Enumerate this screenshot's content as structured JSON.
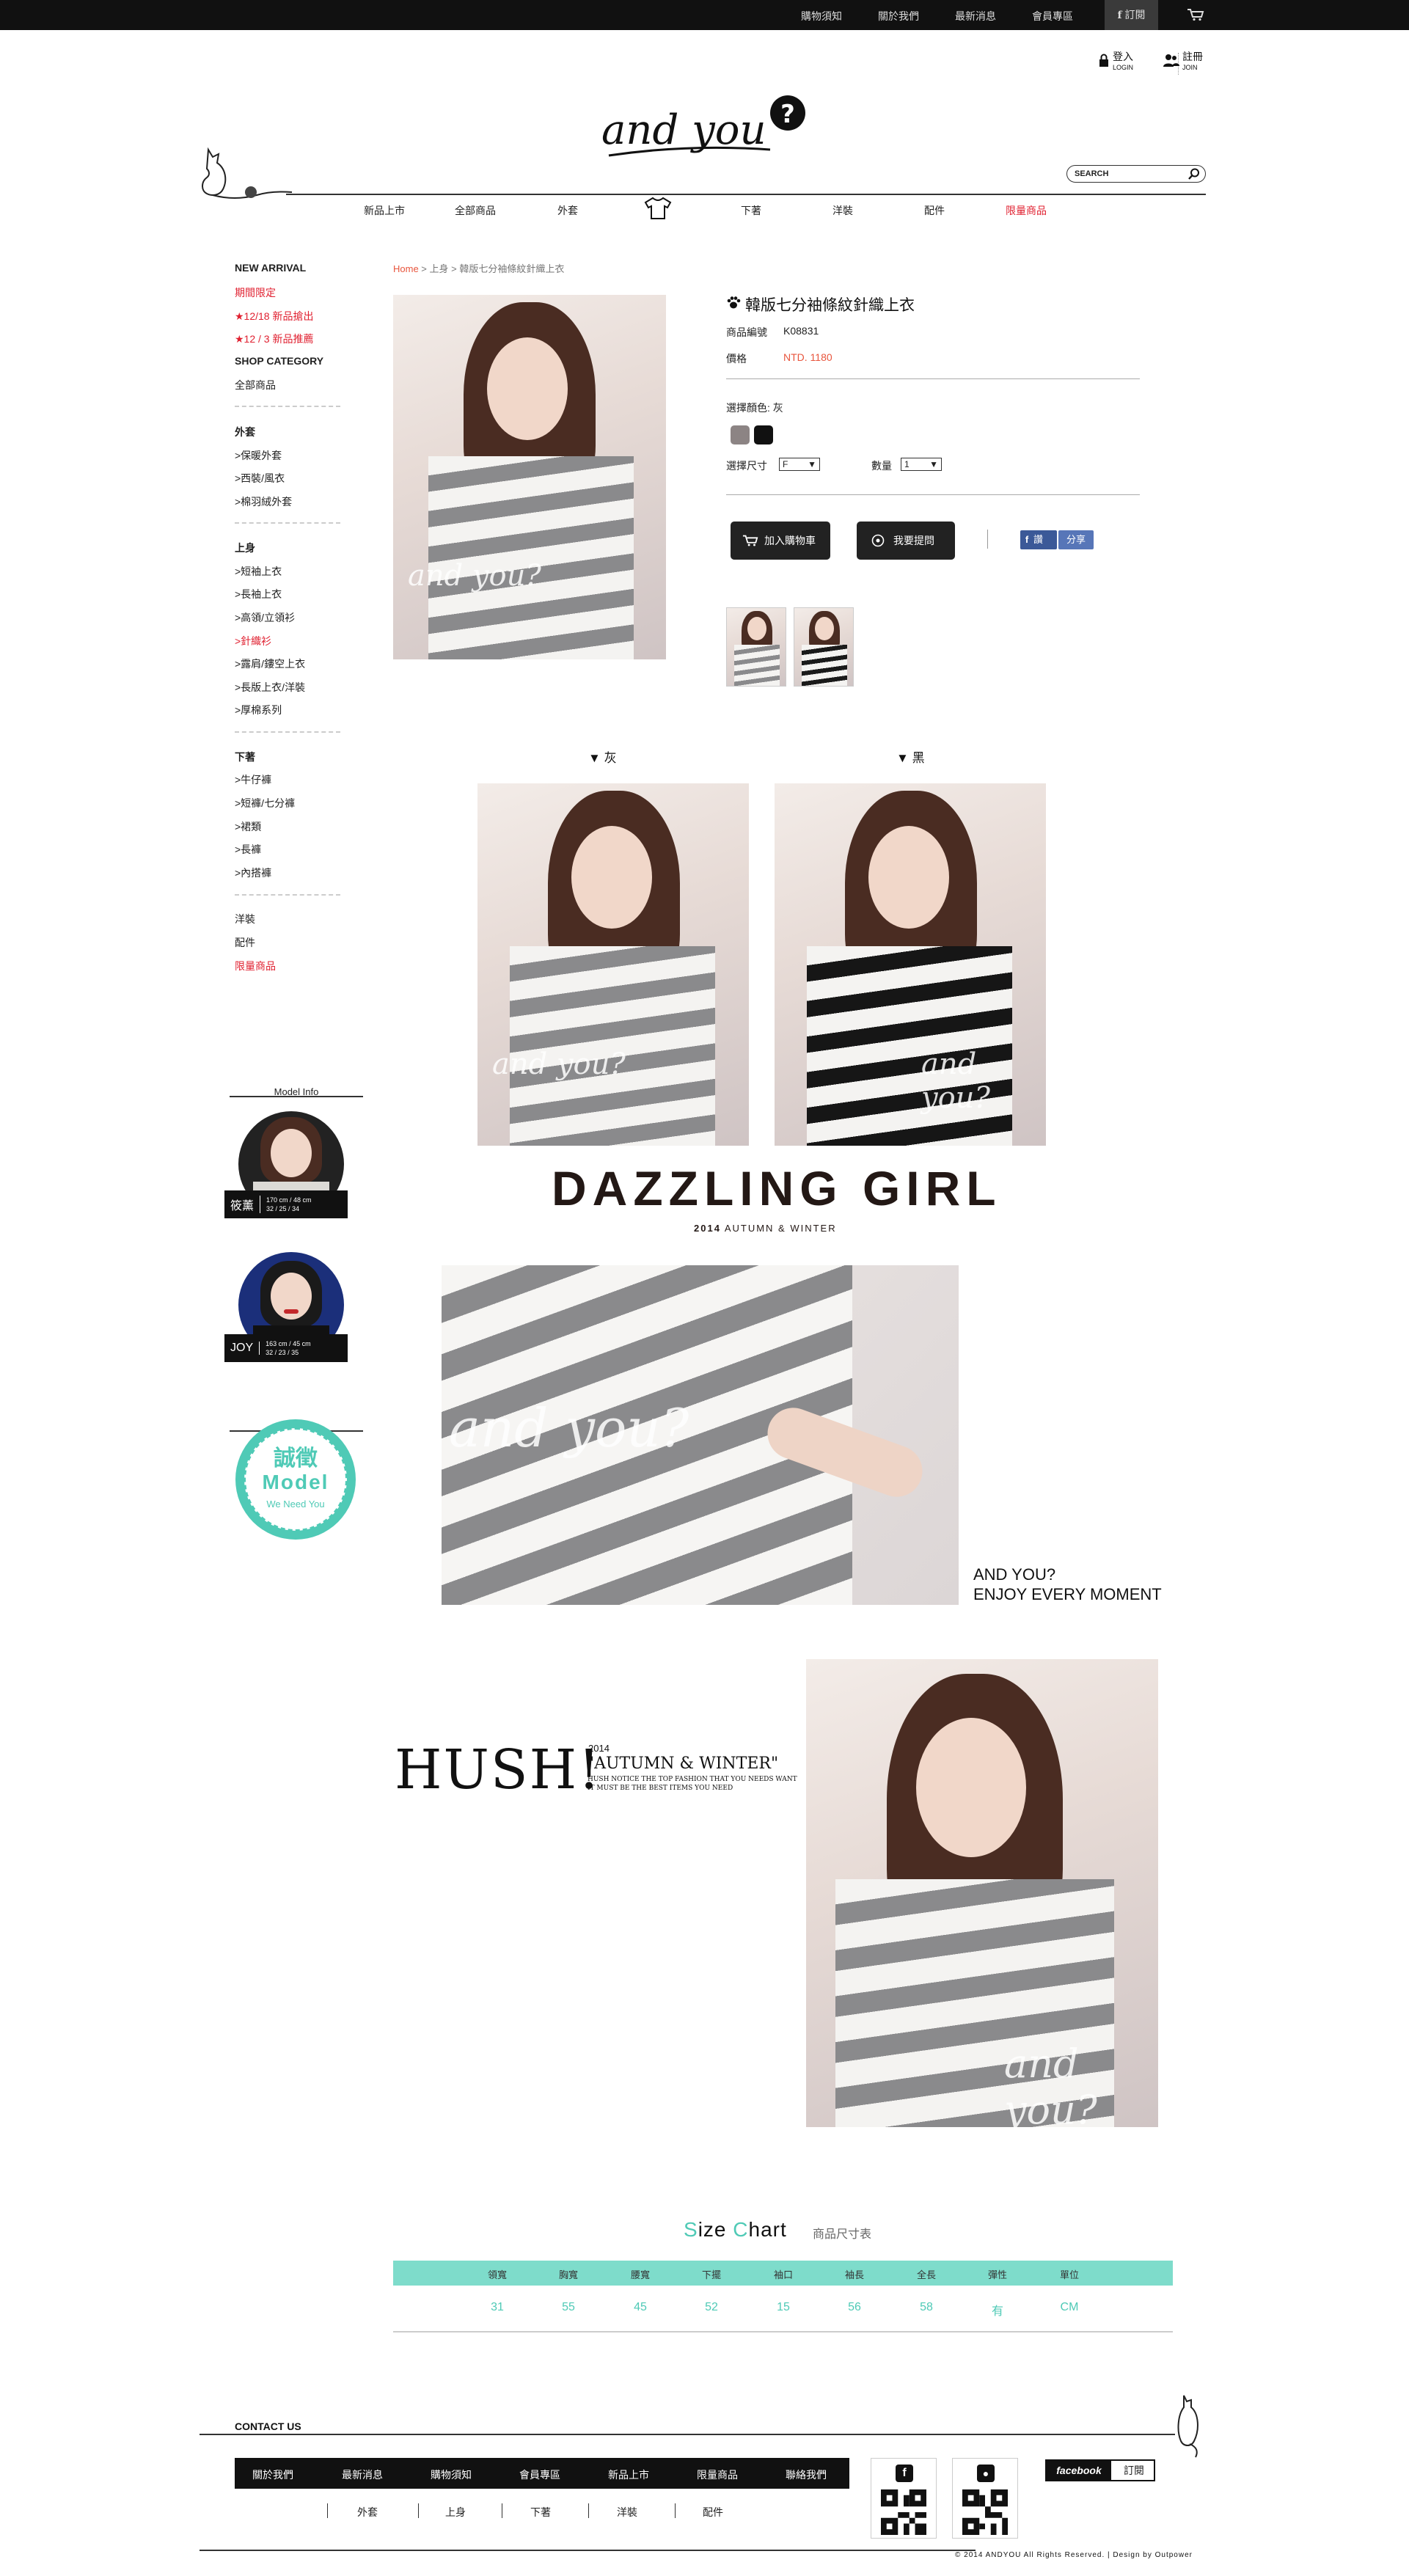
{
  "topbar": {
    "links": [
      "購物須知",
      "關於我們",
      "最新消息",
      "會員專區"
    ],
    "fb_subscribe": "訂閱"
  },
  "header": {
    "login": {
      "zh": "登入",
      "en": "LOGIN"
    },
    "join": {
      "zh": "註冊",
      "en": "JOIN"
    },
    "logo_text": "and you",
    "search_placeholder": "SEARCH",
    "nav": [
      "新品上市",
      "全部商品",
      "外套",
      "下著",
      "洋裝",
      "配件",
      "限量商品"
    ],
    "nav_highlight_color": "#e02030"
  },
  "sidebar": {
    "items": [
      {
        "label": "NEW ARRIVAL",
        "style": "bold"
      },
      {
        "label": "期間限定",
        "style": "red"
      },
      {
        "label": "★12/18 新品搶出",
        "style": "red"
      },
      {
        "label": "★12 / 3 新品推薦",
        "style": "red"
      },
      {
        "label": "SHOP CATEGORY",
        "style": "bold"
      },
      {
        "label": "全部商品",
        "style": "normal"
      },
      {
        "label": "外套",
        "style": "bold"
      },
      {
        "label": ">保暖外套",
        "style": "normal"
      },
      {
        "label": ">西裝/風衣",
        "style": "normal"
      },
      {
        "label": ">棉羽絨外套",
        "style": "normal"
      },
      {
        "label": "上身",
        "style": "bold"
      },
      {
        "label": ">短袖上衣",
        "style": "normal"
      },
      {
        "label": ">長袖上衣",
        "style": "normal"
      },
      {
        "label": ">高領/立領衫",
        "style": "normal"
      },
      {
        "label": ">針織衫",
        "style": "red"
      },
      {
        "label": ">露肩/鏤空上衣",
        "style": "normal"
      },
      {
        "label": ">長版上衣/洋裝",
        "style": "normal"
      },
      {
        "label": ">厚棉系列",
        "style": "normal"
      },
      {
        "label": "下著",
        "style": "bold"
      },
      {
        "label": ">牛仔褲",
        "style": "normal"
      },
      {
        "label": ">短褲/七分褲",
        "style": "normal"
      },
      {
        "label": ">裙類",
        "style": "normal"
      },
      {
        "label": ">長褲",
        "style": "normal"
      },
      {
        "label": ">內搭褲",
        "style": "normal"
      },
      {
        "label": "洋裝",
        "style": "normal"
      },
      {
        "label": "配件",
        "style": "normal"
      },
      {
        "label": "限量商品",
        "style": "red"
      }
    ]
  },
  "breadcrumb": {
    "home": "Home",
    "rest": " > 上身 > 韓版七分袖條紋針織上衣"
  },
  "product": {
    "title": "韓版七分袖條紋針織上衣",
    "code_label": "商品編號",
    "code": "K08831",
    "price_label": "價格",
    "price": "NTD. 1180",
    "price_color": "#e8553d",
    "color_label": "選擇顏色: 灰",
    "colors": [
      "#8c8484",
      "#111111"
    ],
    "size_label": "選擇尺寸",
    "size_value": "F",
    "qty_label": "數量",
    "qty_value": "1",
    "add_cart": "加入購物車",
    "ask": "我要提問",
    "fb_like": "讚",
    "share": "分享"
  },
  "variants": [
    {
      "label": "灰"
    },
    {
      "label": "黑"
    }
  ],
  "banner": {
    "title": "DAZZLING GIRL",
    "year": "2014",
    "season": "AUTUMN & WINTER",
    "andyou_line1": "AND YOU?",
    "andyou_line2": "ENJOY EVERY MOMENT",
    "hush": "HUSH!",
    "hush_year": "2014",
    "hush_season": "\"AUTUMN & WINTER\"",
    "hush_note1": "HUSH NOTICE THE TOP FASHION THAT YOU NEEDS WANT",
    "hush_note2": "IT MUST BE THE BEST ITEMS YOU NEED"
  },
  "photo_signature": "and you?",
  "models": {
    "title": "Model Info",
    "list": [
      {
        "name": "筱薰",
        "stats1": "170 cm / 48 cm",
        "stats2": "32 / 25 / 34"
      },
      {
        "name": "JOY",
        "stats1": "163 cm / 45 cm",
        "stats2": "32 / 23 / 35"
      }
    ],
    "recruit_zh": "誠徵",
    "recruit_en": "Model",
    "recruit_sub": "We Need You"
  },
  "size_chart": {
    "title_a": "S",
    "title_b": "ize ",
    "title_c": "C",
    "title_d": "hart",
    "subtitle": "商品尺寸表",
    "headers": [
      "領寬",
      "胸寬",
      "腰寬",
      "下擺",
      "袖口",
      "袖長",
      "全長",
      "彈性",
      "單位"
    ],
    "values": [
      "31",
      "55",
      "45",
      "52",
      "15",
      "56",
      "58",
      "有",
      "CM"
    ]
  },
  "footer": {
    "contact": "CONTACT US",
    "links": [
      "關於我們",
      "最新消息",
      "購物須知",
      "會員專區",
      "新品上市",
      "限量商品",
      "聯絡我們"
    ],
    "sub_links": [
      "外套",
      "上身",
      "下著",
      "洋裝",
      "配件"
    ],
    "facebook": "facebook",
    "subscribe": "訂閱",
    "copyright": "© 2014 ANDYOU All Rights Reserved. | Design by Outpower"
  }
}
